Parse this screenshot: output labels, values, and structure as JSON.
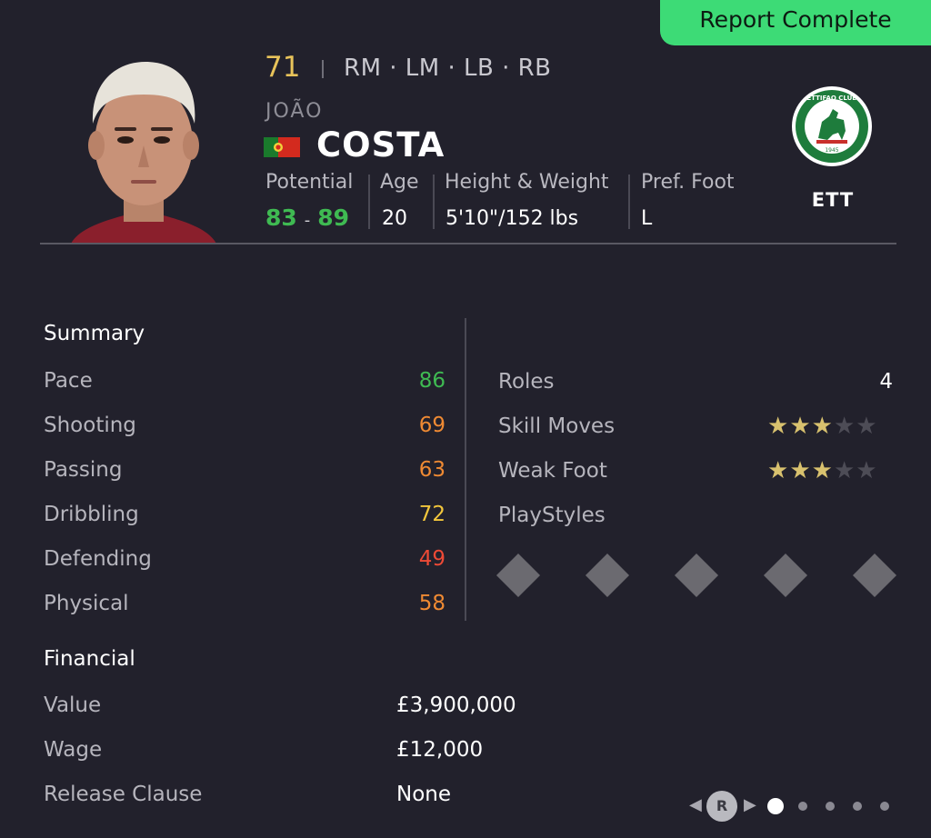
{
  "status_badge": "Report Complete",
  "player": {
    "overall": "71",
    "positions": "RM · LM · LB · RB",
    "first_name": "JOÃO",
    "last_name": "COSTA",
    "potential_label": "Potential",
    "potential_min": "83",
    "potential_dash": "-",
    "potential_max": "89",
    "age_label": "Age",
    "age": "20",
    "hw_label": "Height & Weight",
    "hw": "5'10\"/152 lbs",
    "foot_label": "Pref. Foot",
    "foot": "L"
  },
  "club": {
    "abbr": "ETT",
    "logo_text": "ETTIFAQ CLUB",
    "logo_year": "1945"
  },
  "summary": {
    "title": "Summary",
    "stats": [
      {
        "label": "Pace",
        "value": "86",
        "color": "#3fba52"
      },
      {
        "label": "Shooting",
        "value": "69",
        "color": "#ef8a33"
      },
      {
        "label": "Passing",
        "value": "63",
        "color": "#ef8a33"
      },
      {
        "label": "Dribbling",
        "value": "72",
        "color": "#f2c63c"
      },
      {
        "label": "Defending",
        "value": "49",
        "color": "#ee4a36"
      },
      {
        "label": "Physical",
        "value": "58",
        "color": "#ef8a33"
      }
    ]
  },
  "details": {
    "roles_label": "Roles",
    "roles_value": "4",
    "skill_label": "Skill Moves",
    "skill_stars": 3,
    "weak_label": "Weak Foot",
    "weak_stars": 3,
    "max_stars": 5,
    "playstyles_label": "PlayStyles"
  },
  "financial": {
    "title": "Financial",
    "value_label": "Value",
    "value": "£3,900,000",
    "wage_label": "Wage",
    "wage": "£12,000",
    "release_label": "Release Clause",
    "release": "None"
  },
  "pager": {
    "button": "R",
    "pages": 5,
    "active": 0
  },
  "colors": {
    "accent": "#3ddb76",
    "overall": "#e8c35a",
    "potential": "#3fba52"
  }
}
